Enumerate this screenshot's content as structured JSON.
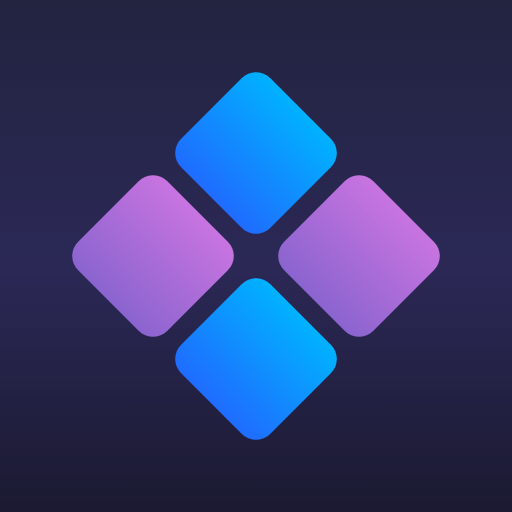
{
  "icon": {
    "name": "four-diamond-tiles-logo",
    "colors": {
      "background_top": "#222440",
      "background_middle": "#2b2856",
      "background_bottom": "#1b1a31",
      "blue_tile_top": "#00b2ff",
      "blue_tile_bottom": "#1f6cff",
      "purple_tile_top": "#c874e0",
      "purple_tile_bottom": "#8b64cf"
    },
    "tiles": [
      {
        "id": "top",
        "color": "blue"
      },
      {
        "id": "left",
        "color": "purple"
      },
      {
        "id": "right",
        "color": "purple"
      },
      {
        "id": "bottom",
        "color": "blue"
      }
    ]
  }
}
